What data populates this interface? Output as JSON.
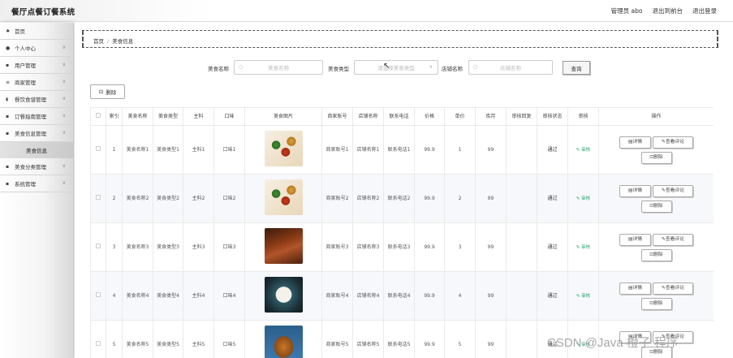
{
  "app": {
    "title": "餐厅点餐订餐系统"
  },
  "header": {
    "user": "管理员 abo",
    "back_front": "退出到前台",
    "logout": "退出登录"
  },
  "sidebar": {
    "items": [
      {
        "icon": "home-icon",
        "glyph": "♠",
        "label": "首页",
        "arrow": ""
      },
      {
        "icon": "user-icon",
        "glyph": "●",
        "label": "个人中心",
        "arrow": "∨"
      },
      {
        "icon": "grid-icon",
        "glyph": "▪",
        "label": "用户管理",
        "arrow": "∨"
      },
      {
        "icon": "sliders-icon",
        "glyph": "≡",
        "label": "商家管理",
        "arrow": "∨"
      },
      {
        "icon": "bowl-icon",
        "glyph": "◖",
        "label": "餐饮食谱管理",
        "arrow": "∨"
      },
      {
        "icon": "grid-icon",
        "glyph": "▪",
        "label": "订餐指南管理",
        "arrow": "∨"
      },
      {
        "icon": "grid-icon",
        "glyph": "▪",
        "label": "美食信息管理",
        "arrow": "∨"
      }
    ],
    "active_sub": "美食信息",
    "items2": [
      {
        "icon": "grid-icon",
        "glyph": "▪",
        "label": "美食分类管理",
        "arrow": "∨"
      },
      {
        "icon": "grid-icon",
        "glyph": "▪",
        "label": "系统管理",
        "arrow": "∨"
      }
    ]
  },
  "breadcrumb": {
    "home": "首页",
    "sep": "/",
    "current": "美食信息"
  },
  "search": {
    "name_label": "美食名称",
    "name_placeholder": "美食名称",
    "type_label": "美食类型",
    "type_placeholder": "请选择美食类型",
    "shop_label": "店铺名称",
    "shop_placeholder": "店铺名称",
    "query": "查询"
  },
  "actions": {
    "delete": "删除",
    "delete_icon": "trash-icon"
  },
  "table": {
    "columns": [
      "",
      "索引",
      "美食名称",
      "美食类型",
      "主料",
      "口味",
      "美食图片",
      "商家账号",
      "店铺名称",
      "联系电话",
      "价格",
      "单价",
      "库存",
      "审核回复",
      "审核状态",
      "审核",
      "操作"
    ],
    "rows": [
      {
        "idx": "1",
        "name": "美食名称1",
        "type": "美食类型1",
        "main": "主料1",
        "taste": "口味1",
        "img": "food1",
        "account": "商家账号1",
        "shop": "店铺名称1",
        "phone": "联系电话1",
        "price": "99.9",
        "unit": "1",
        "stock": "99",
        "reply": "",
        "status": "通过",
        "audit": "审核"
      },
      {
        "idx": "2",
        "name": "美食名称2",
        "type": "美食类型2",
        "main": "主料2",
        "taste": "口味2",
        "img": "food1",
        "account": "商家账号2",
        "shop": "店铺名称2",
        "phone": "联系电话2",
        "price": "99.9",
        "unit": "2",
        "stock": "99",
        "reply": "",
        "status": "通过",
        "audit": "审核"
      },
      {
        "idx": "3",
        "name": "美食名称3",
        "type": "美食类型3",
        "main": "主料3",
        "taste": "口味3",
        "img": "food3",
        "account": "商家账号3",
        "shop": "店铺名称3",
        "phone": "联系电话3",
        "price": "99.9",
        "unit": "3",
        "stock": "99",
        "reply": "",
        "status": "通过",
        "audit": "审核"
      },
      {
        "idx": "4",
        "name": "美食名称4",
        "type": "美食类型4",
        "main": "主料4",
        "taste": "口味4",
        "img": "food4",
        "account": "商家账号4",
        "shop": "店铺名称4",
        "phone": "联系电话4",
        "price": "99.9",
        "unit": "4",
        "stock": "99",
        "reply": "",
        "status": "通过",
        "audit": "审核"
      },
      {
        "idx": "5",
        "name": "美食名称5",
        "type": "美食类型5",
        "main": "主料5",
        "taste": "口味5",
        "img": "food5",
        "account": "商家账号5",
        "shop": "店铺名称5",
        "phone": "联系电话5",
        "price": "99.9",
        "unit": "5",
        "stock": "99",
        "reply": "",
        "status": "通过",
        "audit": "审核"
      }
    ],
    "op_detail": "详情",
    "op_review": "查看评论",
    "op_delete": "删除"
  },
  "watermark": "CSDN @Java 橙子 程序"
}
